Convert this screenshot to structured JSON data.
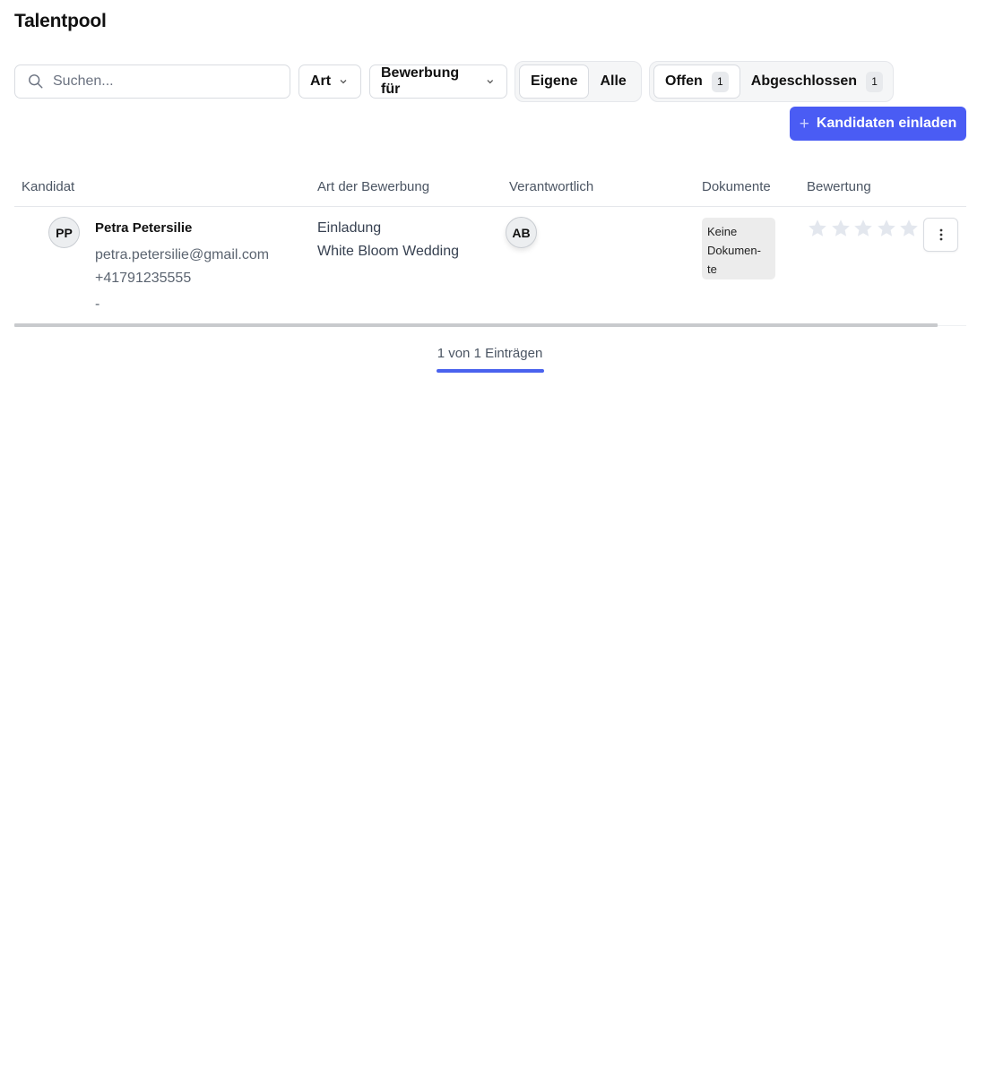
{
  "page": {
    "title": "Talentpool"
  },
  "toolbar": {
    "search_placeholder": "Suchen...",
    "filter_art": "Art",
    "filter_bewerbung": "Bewerbung für",
    "ownership": {
      "own": "Eigene",
      "all": "Alle",
      "selected": "Eigene"
    },
    "status": {
      "open_label": "Offen",
      "open_count": "1",
      "closed_label": "Abgeschlossen",
      "closed_count": "1",
      "selected": "Offen"
    },
    "invite_label": "Kandidaten einladen"
  },
  "table": {
    "columns": [
      "Kandidat",
      "Art der Bewerbung",
      "Verantwortlich",
      "Dokumente",
      "Bewertung"
    ],
    "rows": [
      {
        "initials": "PP",
        "name": "Petra Petersilie",
        "email": "petra.petersilie@gmail.com",
        "phone": "+41791235555",
        "extra": "-",
        "type": "Einladung",
        "position": "White Bloom Wedding",
        "responsible_initials": "AB",
        "documents": [
          "Keine",
          "Dokumen-",
          "te"
        ],
        "rating": 0,
        "rating_max": 5
      }
    ]
  },
  "pagination": {
    "summary": "1 von 1 Einträgen"
  },
  "colors": {
    "accent": "#4a5cf4",
    "star_empty": "#e3e7ee"
  }
}
